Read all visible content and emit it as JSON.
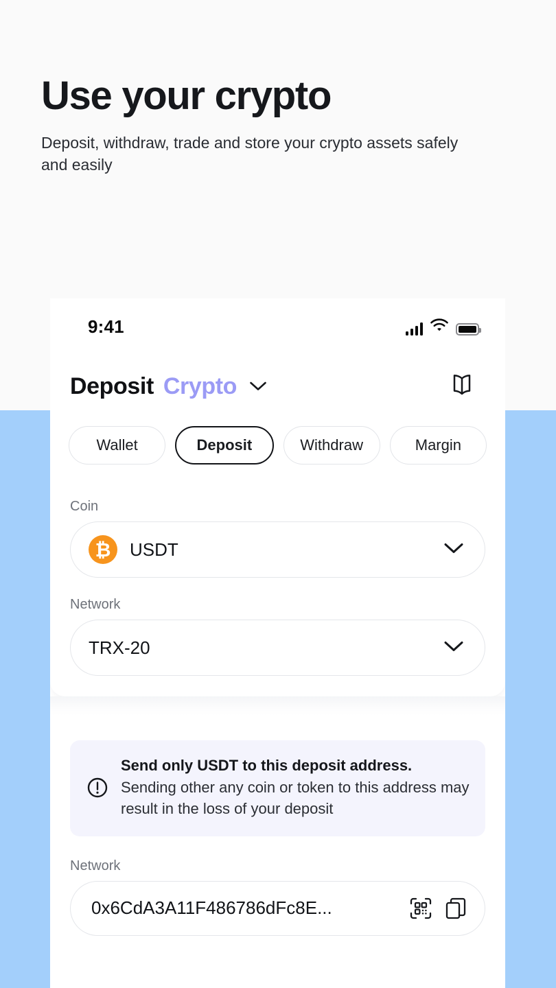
{
  "hero": {
    "title": "Use your crypto",
    "subtitle": "Deposit, withdraw, trade and store  your crypto assets safely and easily"
  },
  "colors": {
    "page_background": "#FAFAFA",
    "band_blue": "#A3CFFB",
    "accent_purple": "#9B9BF5",
    "alert_background": "#F4F4FD",
    "coin_orange": "#F7941D",
    "text_dark": "#111317",
    "text_muted": "#6E727A"
  },
  "phone": {
    "status_bar": {
      "time": "9:41",
      "icons": [
        "cellular-signal-icon",
        "wifi-icon",
        "battery-icon"
      ]
    },
    "header": {
      "title_primary": "Deposit",
      "title_accent": "Crypto",
      "dropdown_icon": "chevron-down-icon",
      "action_icon": "book-icon"
    },
    "tabs": [
      {
        "label": "Wallet",
        "active": false
      },
      {
        "label": "Deposit",
        "active": true
      },
      {
        "label": "Withdraw",
        "active": false
      },
      {
        "label": "Margin",
        "active": false
      }
    ],
    "fields": {
      "coin": {
        "label": "Coin",
        "value": "USDT",
        "coin_symbol": "₿",
        "coin_icon": "bitcoin-icon",
        "chevron": "chevron-down-icon"
      },
      "network": {
        "label": "Network",
        "value": "TRX-20",
        "chevron": "chevron-down-icon"
      }
    },
    "alert": {
      "icon": "exclamation-circle-icon",
      "title": "Send only USDT to this deposit address.",
      "body": "Sending other any coin or token to this address may result in the loss of your deposit"
    },
    "address": {
      "label": "Network",
      "value": "0x6CdA3A11F486786dFc8E...",
      "qr_icon": "qr-code-icon",
      "copy_icon": "copy-icon"
    }
  }
}
